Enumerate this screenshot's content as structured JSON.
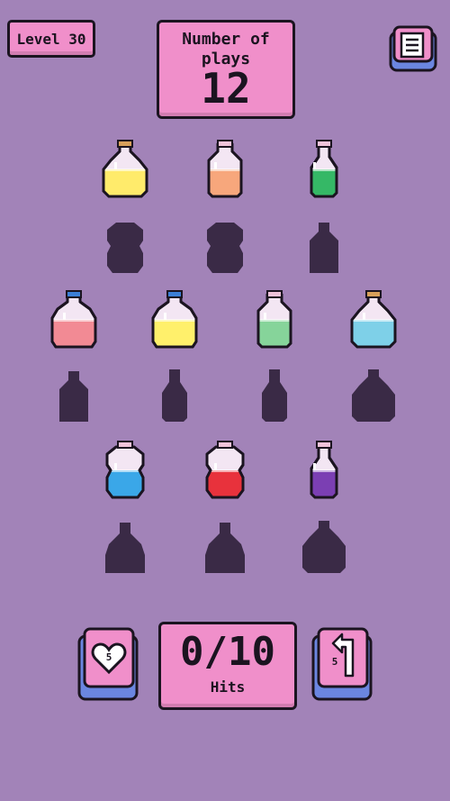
{
  "header": {
    "level_label": "Level 30",
    "plays_title": "Number of plays",
    "plays_value": "12"
  },
  "footer": {
    "hits_value": "0/10",
    "hits_label": "Hits",
    "hint_count": "5",
    "undo_count": "5"
  },
  "icons": {
    "menu": "menu-list-icon",
    "hint": "heart-icon",
    "undo": "undo-arrow-icon"
  },
  "colors": {
    "background": "#a283b8",
    "panel": "#f08fca",
    "shadow": "#3a2a46"
  },
  "bottles": [
    {
      "row": 1,
      "col": 1,
      "shape": "round",
      "liquid": "#ffeb6b",
      "cap": "#d7a05a"
    },
    {
      "row": 1,
      "col": 2,
      "shape": "flask",
      "liquid": "#f7a77c",
      "cap": "#efc3d9"
    },
    {
      "row": 1,
      "col": 3,
      "shape": "potion",
      "liquid": "#35b866",
      "cap": "#efc3d9"
    },
    {
      "row": 3,
      "col": 1,
      "shape": "jug",
      "liquid": "#f28a94",
      "cap": "#3b7fd6"
    },
    {
      "row": 3,
      "col": 2,
      "shape": "jug",
      "liquid": "#fff06b",
      "cap": "#3b7fd6"
    },
    {
      "row": 3,
      "col": 3,
      "shape": "flask",
      "liquid": "#86d49a",
      "cap": "#efc3d9"
    },
    {
      "row": 3,
      "col": 4,
      "shape": "round",
      "liquid": "#7ed0e8",
      "cap": "#d7a05a"
    },
    {
      "row": 5,
      "col": 1,
      "shape": "barrel",
      "liquid": "#3aa7e8",
      "cap": "#efc3d9"
    },
    {
      "row": 5,
      "col": 2,
      "shape": "barrel",
      "liquid": "#e8323c",
      "cap": "#efc3d9"
    },
    {
      "row": 5,
      "col": 3,
      "shape": "potion",
      "liquid": "#7b3fb3",
      "cap": "#efc3d9"
    }
  ],
  "silhouettes": [
    {
      "row": 2,
      "col": 1,
      "shape": "barrel"
    },
    {
      "row": 2,
      "col": 2,
      "shape": "barrel"
    },
    {
      "row": 2,
      "col": 3,
      "shape": "square"
    },
    {
      "row": 4,
      "col": 1,
      "shape": "square"
    },
    {
      "row": 4,
      "col": 2,
      "shape": "potion"
    },
    {
      "row": 4,
      "col": 3,
      "shape": "potion"
    },
    {
      "row": 4,
      "col": 4,
      "shape": "round"
    },
    {
      "row": 6,
      "col": 1,
      "shape": "wide"
    },
    {
      "row": 6,
      "col": 2,
      "shape": "wide"
    },
    {
      "row": 6,
      "col": 3,
      "shape": "round"
    }
  ]
}
